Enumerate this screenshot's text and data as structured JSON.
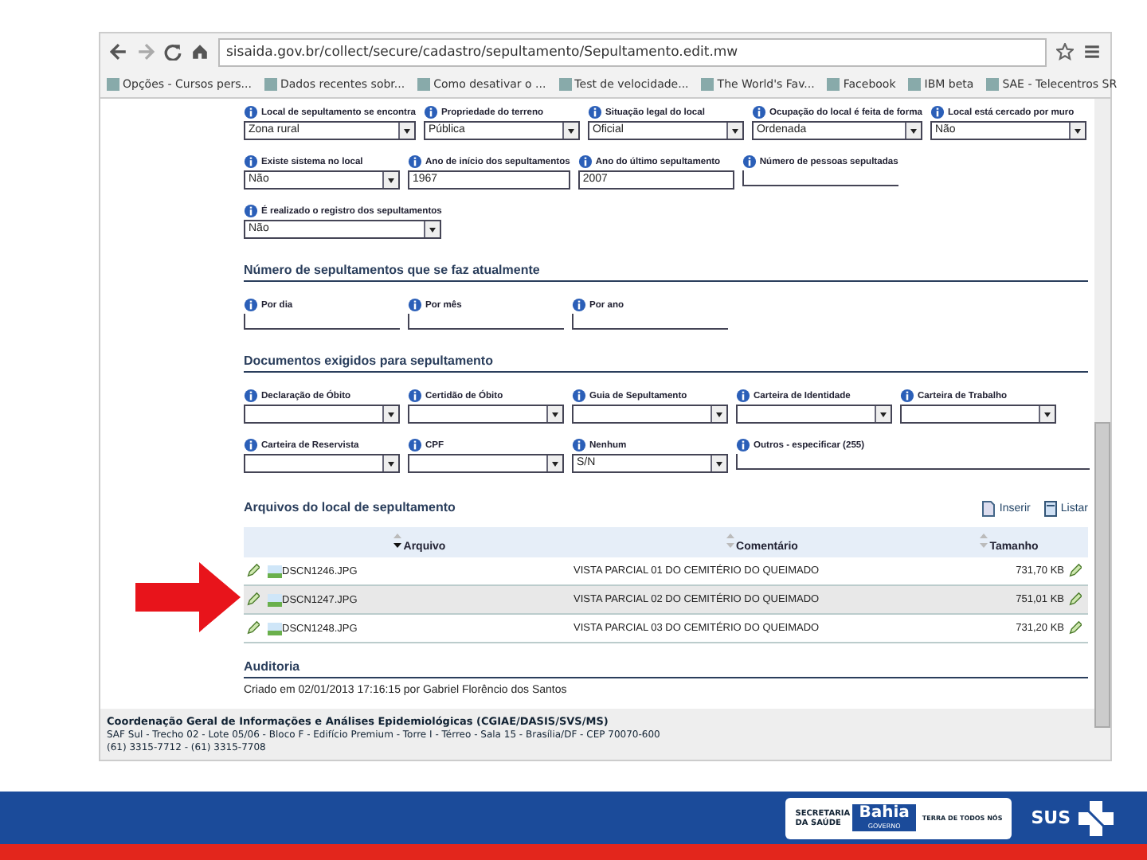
{
  "browser": {
    "url": "sisaida.gov.br/collect/secure/cadastro/sepultamento/Sepultamento.edit.mw",
    "bookmarks": [
      "Opções - Cursos pers...",
      "Dados recentes sobr...",
      "Como desativar o ...",
      "Test de velocidade...",
      "The World's Fav...",
      "Facebook",
      "IBM beta",
      "SAE - Telecentros SR"
    ]
  },
  "form_rows": [
    [
      {
        "label": "Local de sepultamento se encontra",
        "kind": "select",
        "value": "Zona rural"
      },
      {
        "label": "Propriedade do terreno",
        "kind": "select",
        "value": "Pública"
      },
      {
        "label": "Situação legal do local",
        "kind": "select",
        "value": "Oficial"
      },
      {
        "label": "Ocupação do local é feita de forma",
        "kind": "select",
        "value": "Ordenada"
      },
      {
        "label": "Local está cercado por muro",
        "kind": "select",
        "value": "Não"
      }
    ],
    [
      {
        "label": "Existe sistema no local",
        "kind": "select",
        "value": "Não"
      },
      {
        "label": "Ano de início dos sepultamentos",
        "kind": "text",
        "value": "1967"
      },
      {
        "label": "Ano do último sepultamento",
        "kind": "text",
        "value": "2007"
      },
      {
        "label": "Número de pessoas sepultadas",
        "kind": "line"
      }
    ],
    [
      {
        "label": "É realizado o registro dos sepultamentos",
        "kind": "select",
        "value": "Não"
      }
    ]
  ],
  "sections": [
    {
      "title": "Número de sepultamentos que se faz atualmente",
      "rows": [
        [
          {
            "label": "Por dia",
            "kind": "line"
          },
          {
            "label": "Por mês",
            "kind": "line"
          },
          {
            "label": "Por ano",
            "kind": "line"
          }
        ]
      ]
    },
    {
      "title": "Documentos exigidos para sepultamento",
      "rows": [
        [
          {
            "label": "Declaração de Óbito",
            "kind": "select"
          },
          {
            "label": "Certidão de Óbito",
            "kind": "select"
          },
          {
            "label": "Guia de Sepultamento",
            "kind": "select"
          },
          {
            "label": "Carteira de Identidade",
            "kind": "select"
          },
          {
            "label": "Carteira de Trabalho",
            "kind": "select"
          }
        ],
        [
          {
            "label": "Carteira de Reservista",
            "kind": "select"
          },
          {
            "label": "CPF",
            "kind": "select"
          },
          {
            "label": "Nenhum",
            "kind": "select",
            "value": "S/N"
          },
          {
            "label": "Outros - especificar (255)",
            "kind": "wide"
          }
        ]
      ]
    }
  ],
  "files": {
    "title": "Arquivos do local de sepultamento",
    "actions": [
      "Inserir",
      "Listar"
    ],
    "columns": [
      {
        "label": "Arquivo",
        "sorted": true
      },
      {
        "label": "Comentário",
        "sorted": false
      },
      {
        "label": "Tamanho",
        "sorted": false
      }
    ],
    "rows": [
      {
        "file": "DSCN1246.JPG",
        "comment": "VISTA PARCIAL 01 DO CEMITÉRIO DO QUEIMADO",
        "size": "731,70 KB",
        "selected": false
      },
      {
        "file": "DSCN1247.JPG",
        "comment": "VISTA PARCIAL 02 DO CEMITÉRIO DO QUEIMADO",
        "size": "751,01 KB",
        "selected": true
      },
      {
        "file": "DSCN1248.JPG",
        "comment": "VISTA PARCIAL 03 DO CEMITÉRIO DO QUEIMADO",
        "size": "731,20 KB",
        "selected": false
      }
    ]
  },
  "audit": {
    "title": "Auditoria",
    "created": "Criado em 02/01/2013 17:16:15 por Gabriel Florêncio dos Santos"
  },
  "footer": {
    "org": "Coordenação Geral de Informações e Análises Epidemiológicas (CGIAE/DASIS/SVS/MS)",
    "address": "SAF Sul - Trecho 02 - Lote 05/06 - Bloco F - Edifício Premium - Torre I - Térreo - Sala 15 - Brasília/DF - CEP 70070-600",
    "phones": "(61) 3315-7712 - (61) 3315-7708"
  },
  "slide_footer": {
    "secretaria": "SECRETARIA DA SAÚDE",
    "state": "Bahia",
    "government": "GOVERNO",
    "motto": "TERRA DE TODOS NÓS",
    "sus": "SUS"
  }
}
